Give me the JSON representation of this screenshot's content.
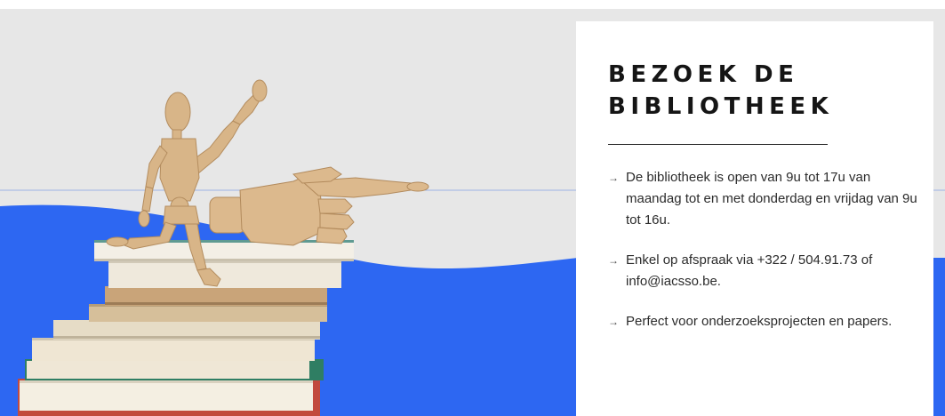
{
  "section": {
    "title": "BEZOEK DE BIBLIOTHEEK",
    "info_items": [
      {
        "arrow_icon": "arrow-right-icon",
        "text": "De bibliotheek is open van 9u tot 17u van maandag tot en met donderdag en vrijdag van 9u tot 16u."
      },
      {
        "arrow_icon": "arrow-right-icon",
        "text": "Enkel op afspraak via +322 / 504.91.73 of info@iacsso.be."
      },
      {
        "arrow_icon": "arrow-right-icon",
        "text": "Perfect voor onderzoeksprojecten en papers."
      }
    ]
  },
  "colors": {
    "background_gray": "#e7e7e7",
    "wave_blue": "#2d67f2",
    "card_white": "#ffffff",
    "title_text": "#151515",
    "body_text": "#2b2b2b"
  },
  "illustration": {
    "subject": "wooden-mannequin-on-book-stack-pointing-hand"
  }
}
